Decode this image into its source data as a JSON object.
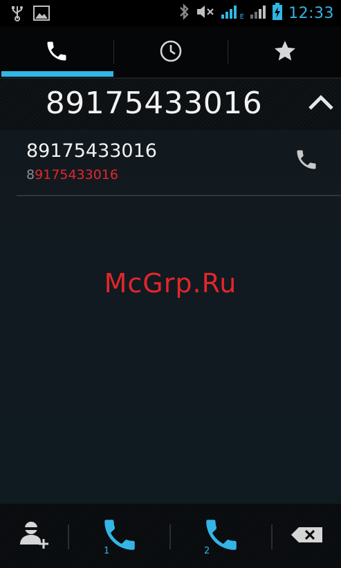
{
  "status_bar": {
    "time": "12:33",
    "network_label": "E",
    "icons": [
      "usb-icon",
      "image-icon",
      "bluetooth-icon",
      "mute-icon",
      "signal-icon",
      "signal-icon",
      "battery-charging-icon"
    ]
  },
  "tabs": [
    {
      "name": "dialer",
      "icon": "phone-icon",
      "selected": true
    },
    {
      "name": "call-log",
      "icon": "clock-icon",
      "selected": false
    },
    {
      "name": "favorites",
      "icon": "star-icon",
      "selected": false
    }
  ],
  "dialer": {
    "number": "89175433016",
    "collapse_icon": "chevron-up-icon"
  },
  "results": [
    {
      "name": "89175433016",
      "number_prefix": "8",
      "number_match": "9175433016",
      "call_icon": "phone-icon"
    }
  ],
  "watermark": "McGrp.Ru",
  "actions": {
    "add_contact_icon": "add-contact-icon",
    "call_sim1_label": "1",
    "call_sim2_label": "2",
    "delete_icon": "backspace-icon"
  },
  "colors": {
    "accent": "#33b5e5",
    "highlight": "#e3262b"
  }
}
